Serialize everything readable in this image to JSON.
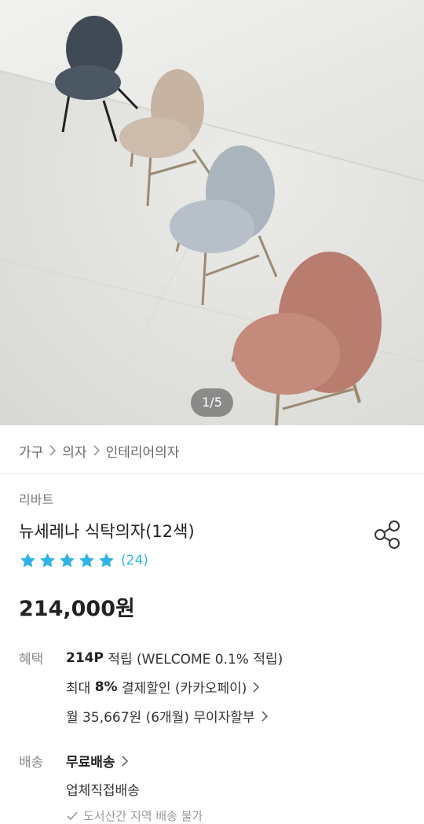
{
  "hero": {
    "pager": "1/5",
    "image_alt": "four dining chairs"
  },
  "breadcrumb": [
    "가구",
    "의자",
    "인테리어의자"
  ],
  "product": {
    "brand": "리바트",
    "title": "뉴세레나 식탁의자(12색)",
    "rating_stars": 5,
    "review_count": "(24)",
    "price": "214,000원"
  },
  "benefit": {
    "label": "혜택",
    "point_strong": "214P",
    "point_rest": " 적립 (WELCOME 0.1% 적립)",
    "discount_prefix": "최대 ",
    "discount_strong": "8%",
    "discount_rest": " 결제할인 (카카오페이)",
    "installment": "월 35,667원 (6개월) 무이자할부"
  },
  "delivery": {
    "label": "배송",
    "free": "무료배송",
    "method": "업체직접배송",
    "note": "도서산간 지역 배송 불가"
  },
  "colors": {
    "star": "#2fb3e6",
    "chair1": "#44505b",
    "chair2": "#c9b7a6",
    "chair3": "#b3bcc4",
    "chair4": "#c48a7b"
  }
}
